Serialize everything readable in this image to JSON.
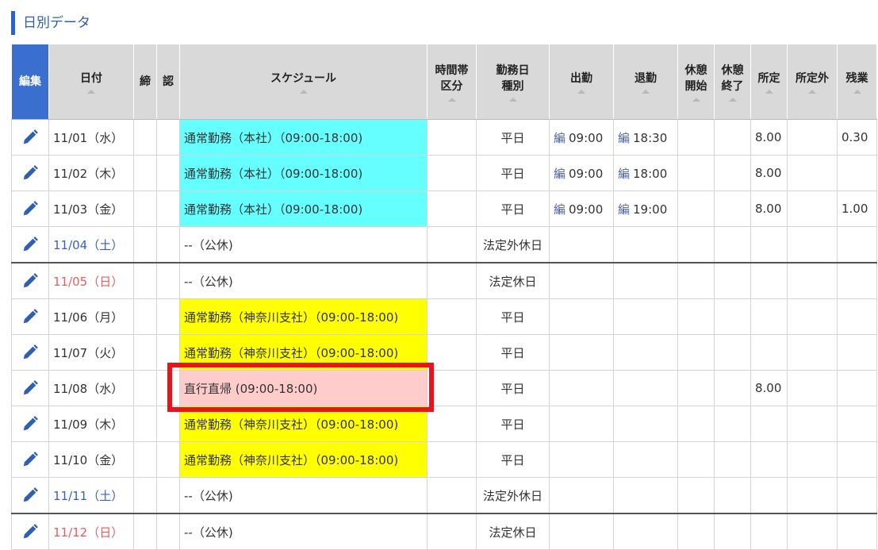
{
  "section_title": "日別データ",
  "headers": {
    "edit": "編集",
    "date": "日付",
    "close": "締",
    "approve": "認",
    "schedule": "スケジュール",
    "time_zone_1": "時間帯",
    "time_zone_2": "区分",
    "work_day_1": "勤務日",
    "work_day_2": "種別",
    "clock_in": "出勤",
    "clock_out": "退勤",
    "break_start_1": "休憩",
    "break_start_2": "開始",
    "break_end_1": "休憩",
    "break_end_2": "終了",
    "regular": "所定",
    "non_regular": "所定外",
    "overtime": "残業"
  },
  "edit_mark": "編",
  "rows": [
    {
      "date": "11/01（水）",
      "schedule": "通常勤務（本社）（09:00-18:00)",
      "day_type": "平日",
      "clock_in": "09:00",
      "clock_out": "18:30",
      "regular": "8.00",
      "overtime": "0.30",
      "sched_color": "cyan",
      "date_color": "normal"
    },
    {
      "date": "11/02（木）",
      "schedule": "通常勤務（本社）（09:00-18:00)",
      "day_type": "平日",
      "clock_in": "09:00",
      "clock_out": "18:00",
      "regular": "8.00",
      "overtime": "",
      "sched_color": "cyan",
      "date_color": "normal"
    },
    {
      "date": "11/03（金）",
      "schedule": "通常勤務（本社）（09:00-18:00)",
      "day_type": "平日",
      "clock_in": "09:00",
      "clock_out": "19:00",
      "regular": "8.00",
      "overtime": "1.00",
      "sched_color": "cyan",
      "date_color": "normal"
    },
    {
      "date": "11/04（土）",
      "schedule": "--（公休)",
      "day_type": "法定外休日",
      "clock_in": "",
      "clock_out": "",
      "regular": "",
      "overtime": "",
      "sched_color": "none",
      "date_color": "sat"
    },
    {
      "date": "11/05（日）",
      "schedule": "--（公休)",
      "day_type": "法定休日",
      "clock_in": "",
      "clock_out": "",
      "regular": "",
      "overtime": "",
      "sched_color": "none",
      "date_color": "sun"
    },
    {
      "date": "11/06（月）",
      "schedule": "通常勤務（神奈川支社）（09:00-18:00)",
      "day_type": "平日",
      "clock_in": "",
      "clock_out": "",
      "regular": "",
      "overtime": "",
      "sched_color": "yellow",
      "date_color": "normal"
    },
    {
      "date": "11/07（火）",
      "schedule": "通常勤務（神奈川支社）（09:00-18:00)",
      "day_type": "平日",
      "clock_in": "",
      "clock_out": "",
      "regular": "",
      "overtime": "",
      "sched_color": "yellow",
      "date_color": "normal"
    },
    {
      "date": "11/08（水）",
      "schedule": "直行直帰 (09:00-18:00)",
      "day_type": "平日",
      "clock_in": "",
      "clock_out": "",
      "regular": "8.00",
      "overtime": "",
      "sched_color": "pink",
      "date_color": "normal"
    },
    {
      "date": "11/09（木）",
      "schedule": "通常勤務（神奈川支社）（09:00-18:00)",
      "day_type": "平日",
      "clock_in": "",
      "clock_out": "",
      "regular": "",
      "overtime": "",
      "sched_color": "yellow",
      "date_color": "normal"
    },
    {
      "date": "11/10（金）",
      "schedule": "通常勤務（神奈川支社）（09:00-18:00)",
      "day_type": "平日",
      "clock_in": "",
      "clock_out": "",
      "regular": "",
      "overtime": "",
      "sched_color": "yellow",
      "date_color": "normal"
    },
    {
      "date": "11/11（土）",
      "schedule": "--（公休)",
      "day_type": "法定外休日",
      "clock_in": "",
      "clock_out": "",
      "regular": "",
      "overtime": "",
      "sched_color": "none",
      "date_color": "sat"
    },
    {
      "date": "11/12（日）",
      "schedule": "--（公休)",
      "day_type": "法定休日",
      "clock_in": "",
      "clock_out": "",
      "regular": "",
      "overtime": "",
      "sched_color": "none",
      "date_color": "sun"
    }
  ],
  "colors": {
    "accent": "#3a6fd0",
    "cyan": "#66ffff",
    "yellow": "#ffff00",
    "pink": "#ffcccc",
    "highlight": "#e8141b"
  }
}
